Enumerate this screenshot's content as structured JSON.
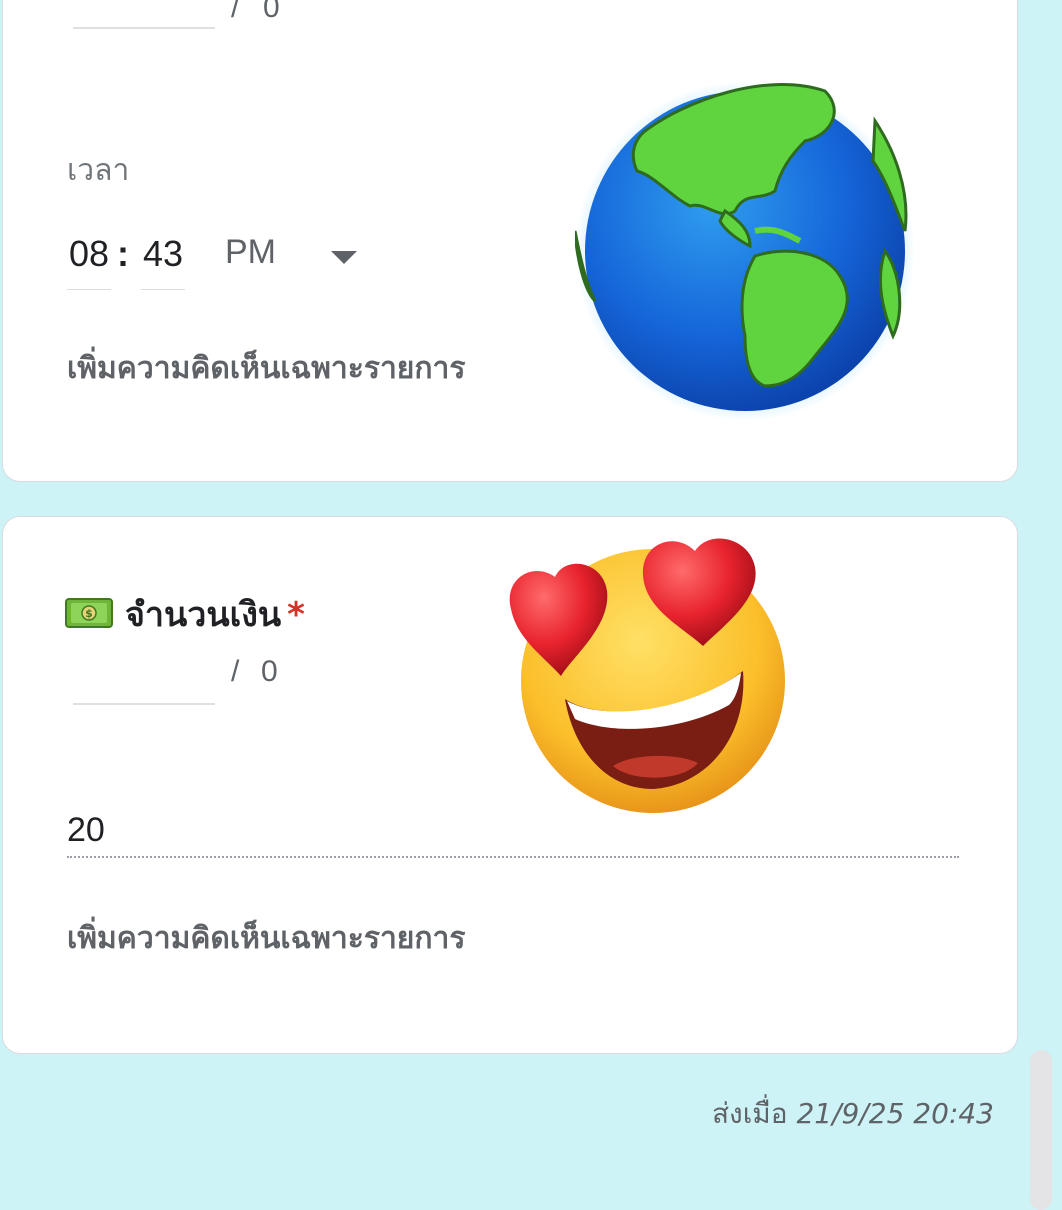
{
  "time_question": {
    "previous_counter_slash": "/",
    "previous_counter_value": "0",
    "label": "เวลา",
    "hour": "08",
    "separator": ":",
    "minute": "43",
    "ampm": "PM",
    "comment_link": "เพิ่มความคิดเห็นเฉพาะรายการ"
  },
  "amount_question": {
    "title": "จำนวนเงิน",
    "required_mark": "*",
    "icon": "money-bill-icon",
    "counter_slash": "/",
    "counter_value": "0",
    "answer": "20",
    "comment_link": "เพิ่มความคิดเห็นเฉพาะรายการ"
  },
  "footer": {
    "sent_label": "ส่งเมื่อ",
    "sent_time": "21/9/25 20:43"
  },
  "colors": {
    "background": "#cdf3f6",
    "card": "#ffffff",
    "required": "#d93025"
  }
}
